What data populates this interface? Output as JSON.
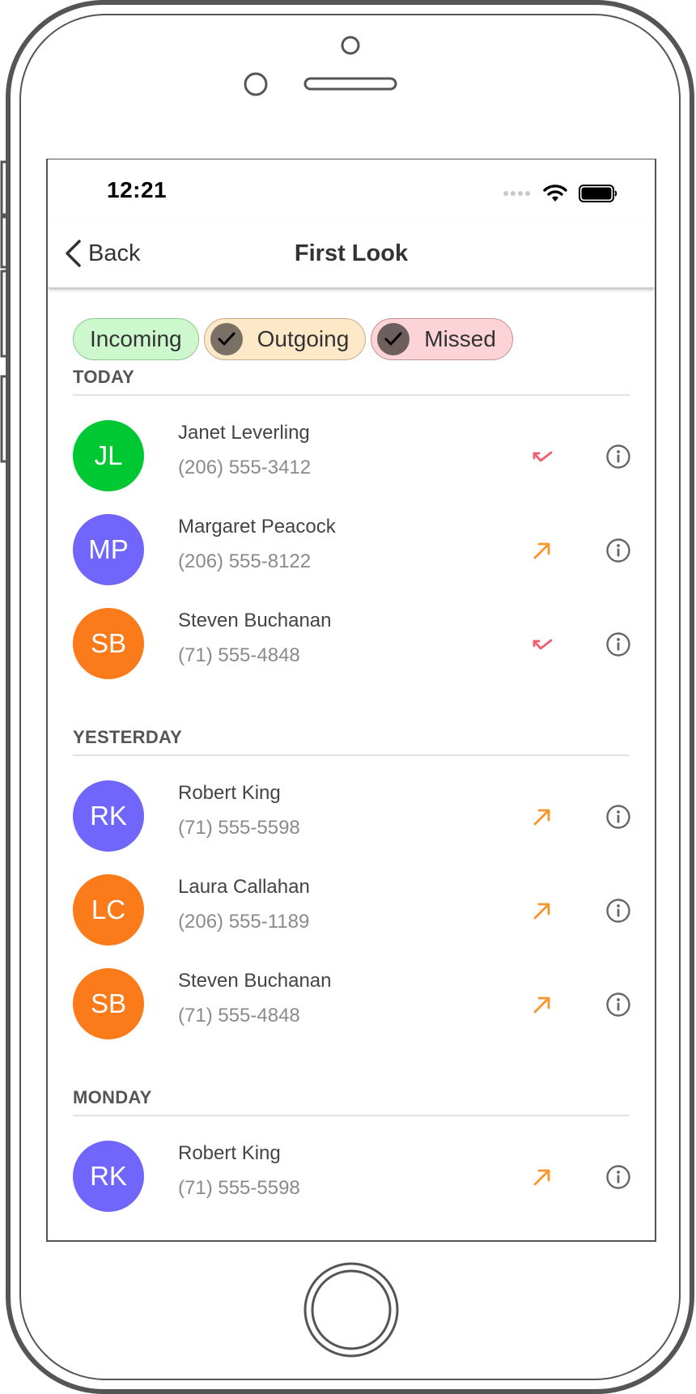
{
  "status_bar": {
    "time": "12:21"
  },
  "nav": {
    "back_label": "Back",
    "title": "First Look"
  },
  "filters": [
    {
      "label": "Incoming",
      "checked": false,
      "color": "#cdf7cd"
    },
    {
      "label": "Outgoing",
      "checked": true,
      "color": "#fde8c8"
    },
    {
      "label": "Missed",
      "checked": true,
      "color": "#fcd3d6"
    }
  ],
  "colors": {
    "green": "#00c832",
    "purple": "#7166fb",
    "orange": "#fb7a1a",
    "missed_icon": "#f25c6c",
    "outgoing_icon": "#f9952a"
  },
  "sections": [
    {
      "title": "TODAY",
      "calls": [
        {
          "initials": "JL",
          "name": "Janet Leverling",
          "number": "(206) 555-3412",
          "type": "missed",
          "avatar_color": "#00c832"
        },
        {
          "initials": "MP",
          "name": "Margaret Peacock",
          "number": "(206) 555-8122",
          "type": "outgoing",
          "avatar_color": "#7166fb"
        },
        {
          "initials": "SB",
          "name": "Steven Buchanan",
          "number": "(71) 555-4848",
          "type": "missed",
          "avatar_color": "#fb7a1a"
        }
      ]
    },
    {
      "title": "YESTERDAY",
      "calls": [
        {
          "initials": "RK",
          "name": "Robert King",
          "number": "(71) 555-5598",
          "type": "outgoing",
          "avatar_color": "#7166fb"
        },
        {
          "initials": "LC",
          "name": "Laura Callahan",
          "number": "(206) 555-1189",
          "type": "outgoing",
          "avatar_color": "#fb7a1a"
        },
        {
          "initials": "SB",
          "name": "Steven Buchanan",
          "number": "(71) 555-4848",
          "type": "outgoing",
          "avatar_color": "#fb7a1a"
        }
      ]
    },
    {
      "title": "MONDAY",
      "calls": [
        {
          "initials": "RK",
          "name": "Robert King",
          "number": "(71) 555-5598",
          "type": "outgoing",
          "avatar_color": "#7166fb"
        }
      ]
    }
  ]
}
